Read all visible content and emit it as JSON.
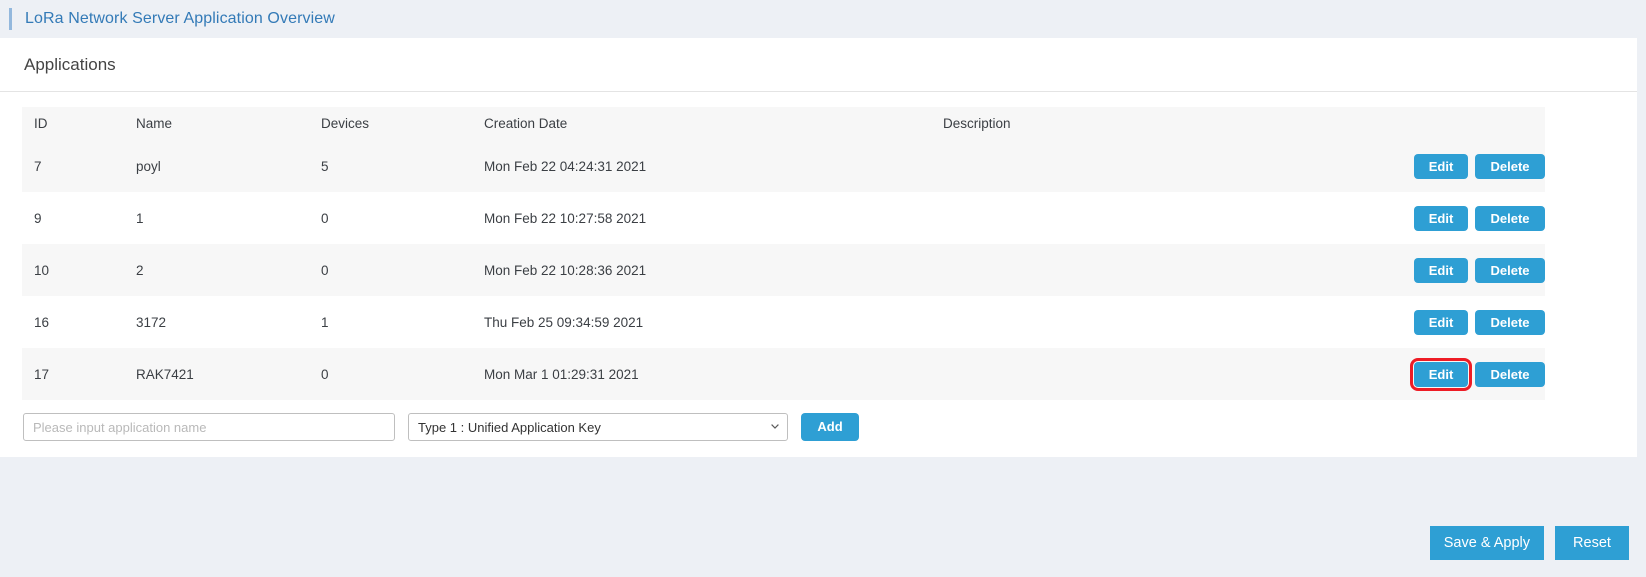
{
  "header": {
    "title": "LoRa Network Server Application Overview",
    "accent_color": "#93b8dd",
    "title_color": "#337ab7"
  },
  "card": {
    "heading": "Applications"
  },
  "table": {
    "columns": [
      "ID",
      "Name",
      "Devices",
      "Creation Date",
      "Description"
    ],
    "rows": [
      {
        "id": "7",
        "name": "poyl",
        "devices": "5",
        "creation_date": "Mon Feb 22 04:24:31 2021",
        "description": "",
        "edit_label": "Edit",
        "delete_label": "Delete",
        "edit_highlighted": false
      },
      {
        "id": "9",
        "name": "1",
        "devices": "0",
        "creation_date": "Mon Feb 22 10:27:58 2021",
        "description": "",
        "edit_label": "Edit",
        "delete_label": "Delete",
        "edit_highlighted": false
      },
      {
        "id": "10",
        "name": "2",
        "devices": "0",
        "creation_date": "Mon Feb 22 10:28:36 2021",
        "description": "",
        "edit_label": "Edit",
        "delete_label": "Delete",
        "edit_highlighted": false
      },
      {
        "id": "16",
        "name": "3172",
        "devices": "1",
        "creation_date": "Thu Feb 25 09:34:59 2021",
        "description": "",
        "edit_label": "Edit",
        "delete_label": "Delete",
        "edit_highlighted": false
      },
      {
        "id": "17",
        "name": "RAK7421",
        "devices": "0",
        "creation_date": "Mon Mar 1 01:29:31 2021",
        "description": "",
        "edit_label": "Edit",
        "delete_label": "Delete",
        "edit_highlighted": true
      }
    ]
  },
  "add_form": {
    "name_placeholder": "Please input application name",
    "name_value": "",
    "key_type_selected": "Type 1 : Unified Application Key",
    "add_label": "Add"
  },
  "footer": {
    "save_label": "Save & Apply",
    "reset_label": "Reset"
  },
  "colors": {
    "button_blue": "#2e9fd4",
    "highlight_red": "#ee1c25",
    "page_background": "#edf0f5",
    "row_stripe": "#f7f7f7"
  }
}
